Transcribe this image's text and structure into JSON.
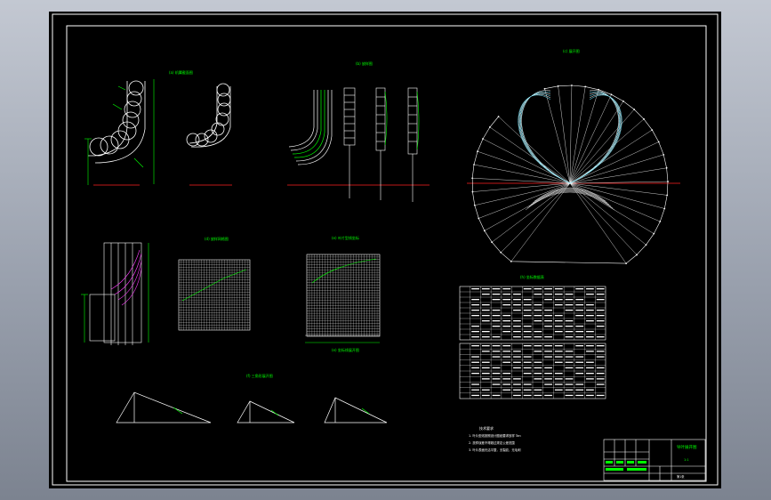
{
  "view": {
    "background": "#000000",
    "frame": "#ffffff",
    "accent": "#00ff00"
  },
  "labels": {
    "fig_a": "(a) 机翼截面图",
    "fig_b": "(b) 放样图",
    "fig_c": "(c) 展开图",
    "fig_d": "(d) 放样网格图",
    "fig_e": "(e) 叶片型线坐标",
    "fig_f": "(f) 三角形展开图",
    "fig_g": "(g) 导叶展开",
    "table_title": "(h) 坐标数据表",
    "grid_caption": "(e) 坐标线展开图"
  },
  "notes": {
    "heading": "技术要求",
    "lines": [
      "1. 叶片型线按照设计图纸要求放样 Tan",
      "2. 放样误差不得超过规定公差范围",
      "3. 叶片表面光洁平整，无裂纹、无毛刺"
    ]
  },
  "title_block": {
    "name": "导叶展开图",
    "scale": "1:1",
    "sheet": "第1张"
  }
}
